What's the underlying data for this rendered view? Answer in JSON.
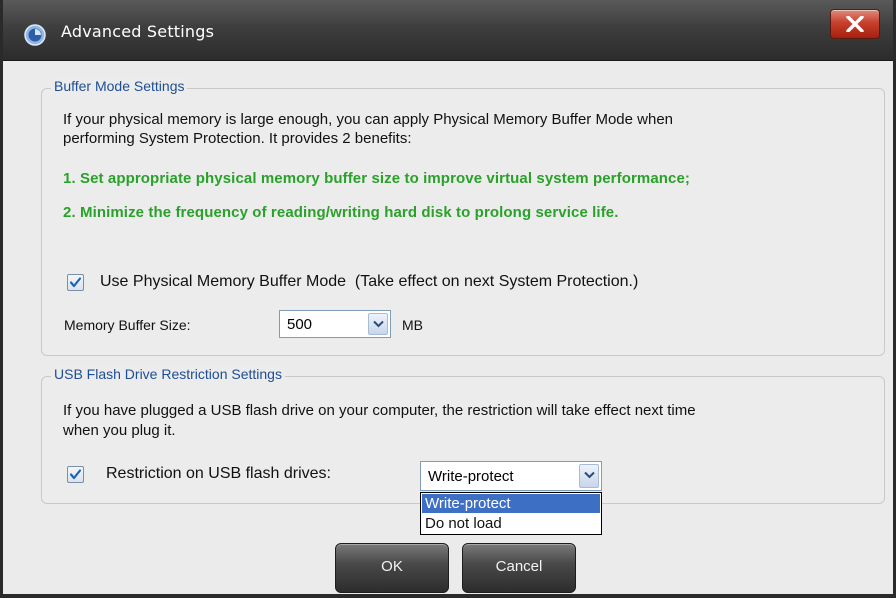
{
  "window": {
    "title": "Advanced Settings",
    "close_label": "×"
  },
  "buffer": {
    "legend": "Buffer Mode Settings",
    "description_line1": "If your physical memory is large enough, you can apply Physical Memory Buffer Mode when",
    "description_line2": "performing System Protection. It provides 2 benefits:",
    "benefit1": "1. Set appropriate physical memory buffer size to improve virtual system performance;",
    "benefit2": "2. Minimize the frequency of reading/writing hard disk to prolong service life.",
    "use_mode_checked": true,
    "use_mode_label": "Use Physical Memory Buffer Mode  (Take effect on next System Protection.)",
    "size_label": "Memory Buffer Size:",
    "size_value": "500",
    "size_unit": "MB"
  },
  "usb": {
    "legend": "USB Flash Drive Restriction Settings",
    "description_line1": "If you have plugged a USB flash drive on your computer, the restriction will take effect next time",
    "description_line2": "when you plug it.",
    "restriction_checked": true,
    "restriction_label": "Restriction on USB flash drives:",
    "restriction_value": "Write-protect",
    "options": [
      "Write-protect",
      "Do not load"
    ],
    "highlighted_option": "Write-protect"
  },
  "buttons": {
    "ok": "OK",
    "cancel": "Cancel"
  },
  "colors": {
    "benefit_text": "#2aa12a",
    "legend_text": "#1e4e96",
    "close_button": "#c8402e",
    "dropdown_highlight": "#3d6fc4"
  }
}
